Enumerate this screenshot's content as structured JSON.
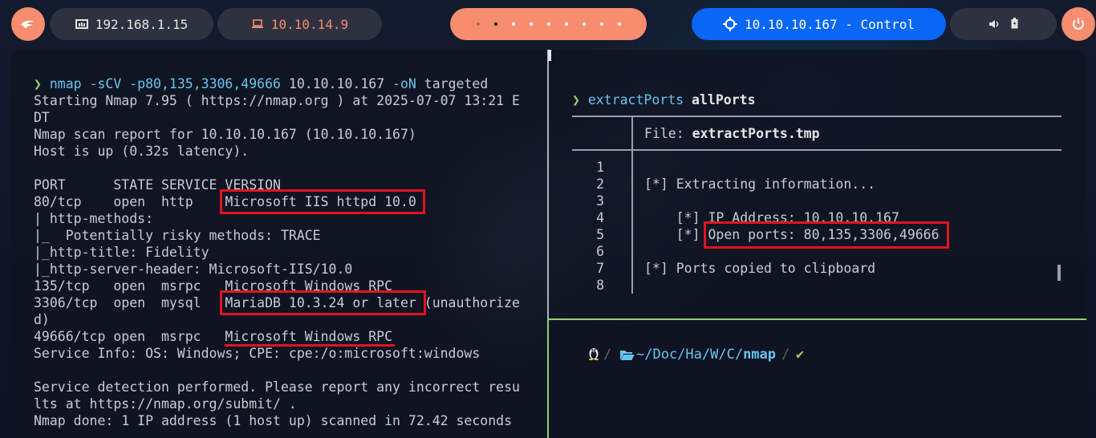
{
  "topbar": {
    "local_ip": "192.168.1.15",
    "vpn_ip": "10.10.14.9",
    "target": "10.10.10.167 - Control",
    "workspaces": [
      "",
      "",
      "",
      "",
      "",
      "",
      "",
      "",
      ""
    ],
    "active_workspace": 2,
    "colors": {
      "accent": "#f58d6e",
      "target_bg": "#0a66f5",
      "pill_bg": "#2e3140"
    },
    "icons": [
      "debian-swirl-icon",
      "network-icon",
      "laptop-icon",
      "crosshair-icon",
      "volume-icon",
      "battery-icon",
      "power-icon"
    ]
  },
  "left_pane": {
    "prompt_arrow": "❯",
    "command": {
      "name": "nmap",
      "args": " -sCV -p80,135,3306,49666",
      "target": " 10.10.10.167",
      "output_flag": " -oN",
      "output_file": " targeted"
    },
    "lines": [
      "Starting Nmap 7.95 ( https://nmap.org ) at 2025-07-07 13:21 E",
      "DT",
      "Nmap scan report for 10.10.10.167 (10.10.10.167)",
      "Host is up (0.32s latency).",
      "",
      "PORT      STATE SERVICE VERSION",
      "80/tcp    open  http    Microsoft IIS httpd 10.0",
      "| http-methods:",
      "|_  Potentially risky methods: TRACE",
      "|_http-title: Fidelity",
      "|_http-server-header: Microsoft-IIS/10.0",
      "135/tcp   open  msrpc   Microsoft Windows RPC",
      "3306/tcp  open  mysql   MariaDB 10.3.24 or later (unauthorize",
      "d)",
      "49666/tcp open  msrpc   Microsoft Windows RPC",
      "Service Info: OS: Windows; CPE: cpe:/o:microsoft:windows",
      "",
      "Service detection performed. Please report any incorrect resu",
      "lts at https://nmap.org/submit/ .",
      "Nmap done: 1 IP address (1 host up) scanned in 72.42 seconds"
    ]
  },
  "right_top_pane": {
    "prompt_arrow": "❯",
    "command": "extractPorts",
    "argument": "allPorts",
    "file_label": "File: ",
    "file_name": "extractPorts.tmp",
    "line_numbers": [
      "1",
      "2",
      "3",
      "4",
      "5",
      "6",
      "7",
      "8"
    ],
    "lines": [
      "",
      "[*] Extracting information...",
      "",
      "    [*] IP Address: 10.10.10.167",
      "    [*] Open ports: 80,135,3306,49666",
      "",
      "[*] Ports copied to clipboard",
      ""
    ]
  },
  "right_bottom_pane": {
    "os_icon": "linux-penguin-icon",
    "folder_icon": "folder-open-icon",
    "path_prefix": "~/Doc/Ha/W/C/",
    "path_current": "nmap",
    "status_ok": "✔"
  }
}
